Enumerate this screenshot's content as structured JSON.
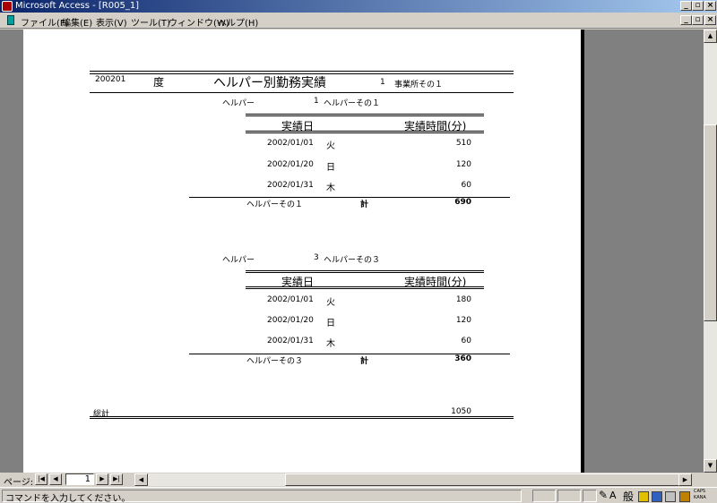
{
  "window": {
    "title": "Microsoft Access - [R005_1]",
    "controls": {
      "minimize": "_",
      "restore": "▫",
      "close": "×"
    }
  },
  "menu": [
    "ファイル(F)",
    "編集(E)",
    "表示(V)",
    "ツール(T)",
    "ウィンドウ(W)",
    "ヘルプ(H)"
  ],
  "report": {
    "year_month": "200201",
    "nendo": "度",
    "title": "ヘルパー別勤務実績",
    "office_no": "1",
    "office_name": "事業所その１",
    "col_date": "実績日",
    "col_time": "実績時間(分)",
    "helper_label": "ヘルパー",
    "total_label": "計",
    "grand_total_label": "総計",
    "grand_total": "1050",
    "groups": [
      {
        "helper_no": "1",
        "helper_name": "ヘルパーその１",
        "rows": [
          {
            "date": "2002/01/01",
            "dow": "火",
            "minutes": "510"
          },
          {
            "date": "2002/01/20",
            "dow": "日",
            "minutes": "120"
          },
          {
            "date": "2002/01/31",
            "dow": "木",
            "minutes": "60"
          }
        ],
        "footer_name": "ヘルパーその１",
        "total": "690"
      },
      {
        "helper_no": "3",
        "helper_name": "ヘルパーその３",
        "rows": [
          {
            "date": "2002/01/01",
            "dow": "火",
            "minutes": "180"
          },
          {
            "date": "2002/01/20",
            "dow": "日",
            "minutes": "120"
          },
          {
            "date": "2002/01/31",
            "dow": "木",
            "minutes": "60"
          }
        ],
        "footer_name": "ヘルパーその３",
        "total": "360"
      }
    ]
  },
  "nav": {
    "page_label": "ページ:",
    "page_number": "1",
    "first": "|◀",
    "prev": "◀",
    "next": "▶",
    "last": "▶|"
  },
  "status": {
    "message": "コマンドを入力してください。",
    "ime_mode": "般",
    "caps": "CAPS",
    "kana": "KANA"
  }
}
